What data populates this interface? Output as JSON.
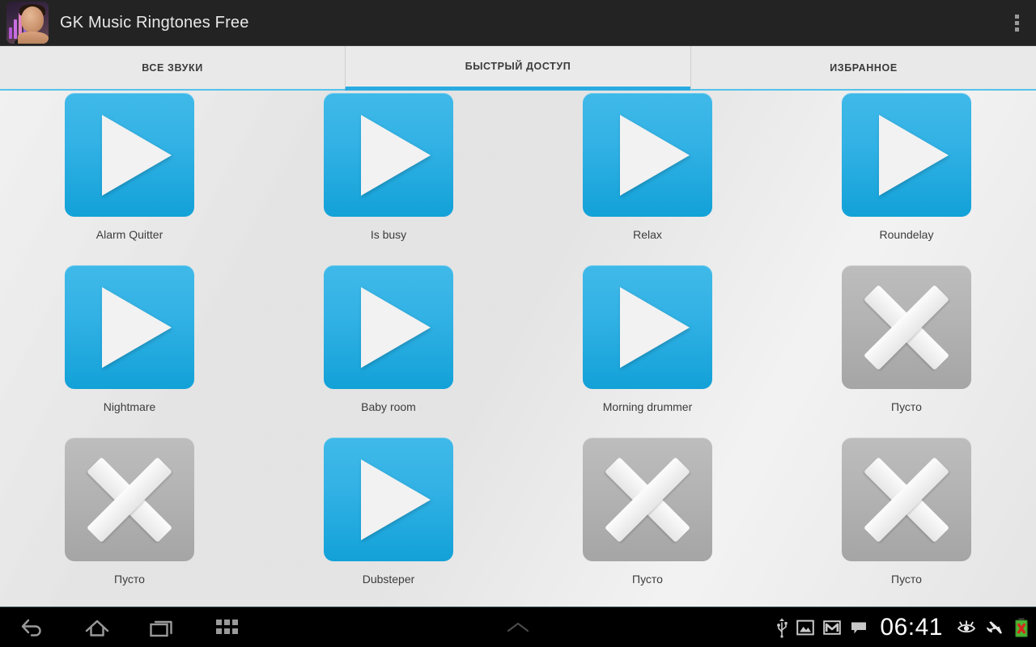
{
  "titlebar": {
    "app_name": "GK Music Ringtones Free",
    "app_icon": "music-eq-face-icon",
    "overflow_menu": "overflow-menu-icon"
  },
  "tabs": [
    {
      "label": "ВСЕ ЗВУКИ",
      "name": "tab-all-sounds",
      "selected": false
    },
    {
      "label": "БЫСТРЫЙ ДОСТУП",
      "name": "tab-quick-access",
      "selected": true
    },
    {
      "label": "ИЗБРАННОЕ",
      "name": "tab-favorites",
      "selected": false
    }
  ],
  "accent_color": "#29abe2",
  "tile_color_play": "#33b2e5",
  "tile_color_empty": "#b3b3b3",
  "grid": {
    "columns": 4,
    "cells": [
      {
        "label": "Alarm Quitter",
        "type": "play"
      },
      {
        "label": "Is busy",
        "type": "play"
      },
      {
        "label": "Relax",
        "type": "play"
      },
      {
        "label": "Roundelay",
        "type": "play"
      },
      {
        "label": "Nightmare",
        "type": "play"
      },
      {
        "label": "Baby room",
        "type": "play"
      },
      {
        "label": "Morning drummer",
        "type": "play"
      },
      {
        "label": "Пусто",
        "type": "empty"
      },
      {
        "label": "Пусто",
        "type": "empty"
      },
      {
        "label": "Dubsteper",
        "type": "play"
      },
      {
        "label": "Пусто",
        "type": "empty"
      },
      {
        "label": "Пусто",
        "type": "empty"
      }
    ]
  },
  "navbar": {
    "buttons": [
      {
        "name": "back-icon"
      },
      {
        "name": "home-icon"
      },
      {
        "name": "recents-icon"
      },
      {
        "name": "app-drawer-icon"
      }
    ],
    "center": {
      "name": "chevron-up-icon"
    },
    "status": {
      "icons": [
        {
          "name": "usb-icon"
        },
        {
          "name": "screenshot-image-icon"
        },
        {
          "name": "gmail-icon"
        },
        {
          "name": "message-bubble-icon"
        },
        {
          "name": "eye-icon"
        },
        {
          "name": "airplane-mode-icon"
        },
        {
          "name": "battery-error-icon"
        }
      ],
      "clock": "06:41"
    }
  }
}
